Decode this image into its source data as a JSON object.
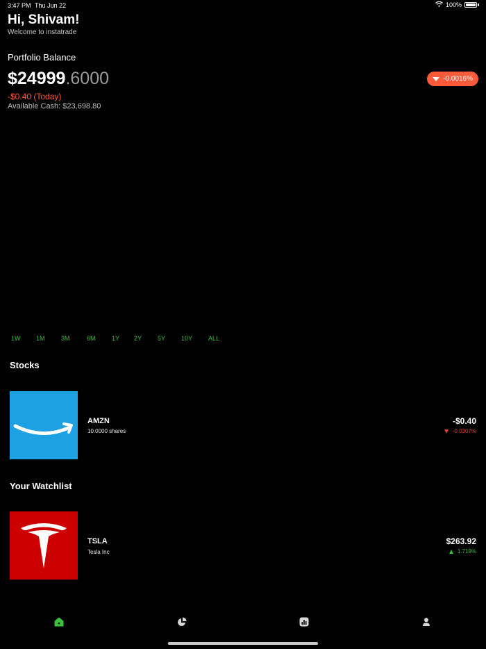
{
  "status": {
    "time": "3:47 PM",
    "date": "Thu Jun 22",
    "battery": "100%"
  },
  "header": {
    "greeting": "Hi, Shivam!",
    "subtitle": "Welcome to instatrade"
  },
  "portfolio": {
    "label": "Portfolio Balance",
    "balance_int": "$24999",
    "balance_dec": ".6000",
    "change": "-$0.40",
    "change_period": "(Today)",
    "available_cash": "Available Cash: $23,698.80",
    "pct_change": "-0.0016%"
  },
  "ranges": [
    "1W",
    "1M",
    "3M",
    "6M",
    "1Y",
    "2Y",
    "5Y",
    "10Y",
    "ALL"
  ],
  "stocks": {
    "title": "Stocks",
    "items": [
      {
        "ticker": "AMZN",
        "sub": "10.0000 shares",
        "value": "-$0.40",
        "change": "-0.0307%",
        "direction": "down"
      }
    ]
  },
  "watchlist": {
    "title": "Your Watchlist",
    "items": [
      {
        "ticker": "TSLA",
        "sub": "Tesla Inc",
        "value": "$263.92",
        "change": "1.719%",
        "direction": "up"
      }
    ]
  },
  "tabbar": {
    "items": [
      "home-icon",
      "portfolio-pie-icon",
      "chart-icon",
      "profile-icon"
    ],
    "active_color": "#3cbf3c"
  },
  "colors": {
    "down": "#ff5a3a",
    "up": "#3cbf3c",
    "amazon_blue": "#1da1e2",
    "tesla_red": "#cc0000"
  }
}
